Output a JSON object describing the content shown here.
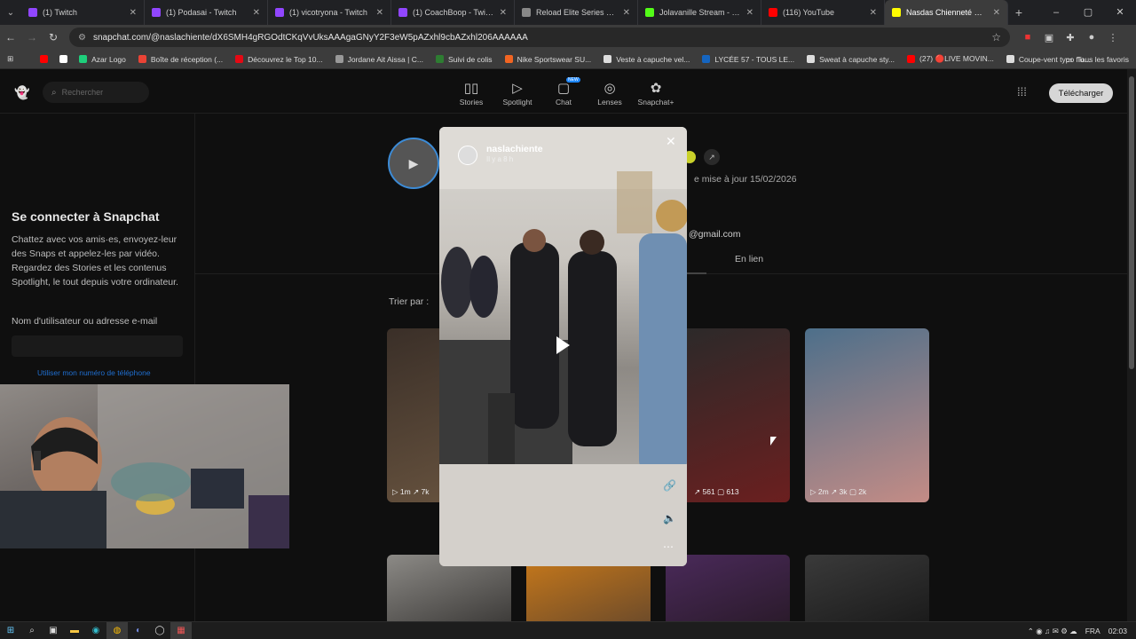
{
  "browser": {
    "tabs": [
      {
        "title": "(1) Twitch",
        "color": "#9146ff"
      },
      {
        "title": "(1) Podasai - Twitch",
        "color": "#9146ff"
      },
      {
        "title": "(1) vicotryona - Twitch",
        "color": "#9146ff"
      },
      {
        "title": "(1) CoachBoop - Twitch",
        "color": "#9146ff"
      },
      {
        "title": "Reload Elite Series Opens",
        "color": "#888888"
      },
      {
        "title": "Jolavanille Stream - Watc",
        "color": "#53fc18"
      },
      {
        "title": "(116) YouTube",
        "color": "#ff0000"
      },
      {
        "title": "Nasdas Chienneté 🐾 (@",
        "color": "#fffc00"
      }
    ],
    "url": "snapchat.com/@naslachiente/dX6SMH4gRGOdtCKqVvUksAAAgaGNyY2F3eW5pAZxhl9cbAZxhl206AAAAAA",
    "bookmarks": [
      {
        "label": "Azar Logo",
        "color": "#1ecf7b"
      },
      {
        "label": "Boîte de réception (...",
        "color": "#ea4335"
      },
      {
        "label": "Découvrez le Top 10...",
        "color": "#e50914"
      },
      {
        "label": "Jordane Ait Aissa | C...",
        "color": "#999999"
      },
      {
        "label": "Suivi de colis",
        "color": "#2e7d32"
      },
      {
        "label": "Nike Sportswear SU...",
        "color": "#f26522"
      },
      {
        "label": "Veste à capuche vel...",
        "color": "#dddddd"
      },
      {
        "label": "LYCÉE 57 - TOUS LE...",
        "color": "#1565c0"
      },
      {
        "label": "Sweat à capuche sty...",
        "color": "#dddddd"
      },
      {
        "label": "(27) 🔴LIVE MOVIN...",
        "color": "#ff0000"
      },
      {
        "label": "Coupe-vent typo flu...",
        "color": "#dddddd"
      }
    ],
    "all_bookmarks": "Tous les favoris"
  },
  "snapchat": {
    "search_placeholder": "Rechercher",
    "nav": [
      {
        "label": "Stories",
        "icon": "stories-icon",
        "glyph": "▯▯"
      },
      {
        "label": "Spotlight",
        "icon": "spotlight-icon",
        "glyph": "▷"
      },
      {
        "label": "Chat",
        "icon": "chat-icon",
        "glyph": "▢",
        "badge": "NEW"
      },
      {
        "label": "Lenses",
        "icon": "lenses-icon",
        "glyph": "◎"
      },
      {
        "label": "Snapchat+",
        "icon": "snapchat-plus-icon",
        "glyph": "✿"
      }
    ],
    "download_label": "Télécharger",
    "sidebar": {
      "title": "Se connecter à Snapchat",
      "description": "Chattez avec vos amis·es, envoyez-leur des Snaps et appelez-les par vidéo. Regardez des Stories et les contenus Spotlight, le tout depuis votre ordinateur.",
      "input_label": "Nom d'utilisateur ou adresse e-mail",
      "phone_link": "Utiliser mon numéro de téléphone"
    },
    "profile": {
      "updated": "e mise à jour 15/02/2026",
      "email": "@gmail.com",
      "tab_online": "En lien",
      "sort_label": "Trier par :"
    },
    "story": {
      "username": "naslachiente",
      "time_ago": "Il y a 8 h"
    },
    "thumbnails": [
      {
        "stats": "▷ 1m  ↗ 7k",
        "color1": "#3a2f28",
        "color2": "#6a5540"
      },
      {
        "stats": "↗ 561  ▢ 613",
        "color1": "#2a2a2a",
        "color2": "#6b1f1f"
      },
      {
        "stats": "▷ 2m  ↗ 3k  ▢ 2k",
        "color1": "#4d6f8a",
        "color2": "#c48c86"
      },
      {
        "stats": "",
        "color1": "#8c8a86",
        "color2": "#3b3937"
      },
      {
        "stats": "",
        "color1": "#c8791a",
        "color2": "#6b4a2a"
      },
      {
        "stats": "",
        "color1": "#4a2a5a",
        "color2": "#2a1a2a"
      },
      {
        "stats": "",
        "color1": "#3a3a3a",
        "color2": "#1a1a1a"
      }
    ]
  },
  "taskbar": {
    "lang": "FRA",
    "time": "02:03"
  }
}
